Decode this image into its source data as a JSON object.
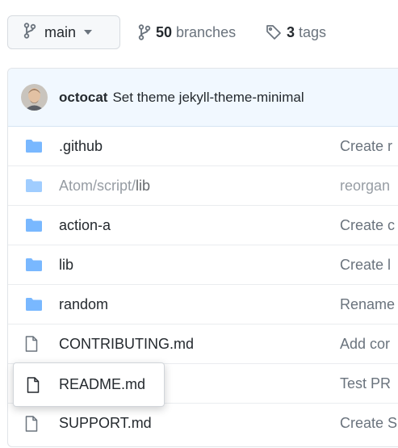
{
  "branch": {
    "name": "main"
  },
  "stats": {
    "branches_count": "50",
    "branches_label": "branches",
    "tags_count": "3",
    "tags_label": "tags"
  },
  "commit": {
    "author": "octocat",
    "message": "Set theme jekyll-theme-minimal"
  },
  "files": [
    {
      "name": ".github",
      "type": "folder",
      "commit_message": "Create r"
    },
    {
      "name_dim": "Atom/script/",
      "name": "lib",
      "type": "folder",
      "commit_message": "reorgan"
    },
    {
      "name": "action-a",
      "type": "folder",
      "commit_message": "Create c"
    },
    {
      "name": "lib",
      "type": "folder",
      "commit_message": "Create l"
    },
    {
      "name": "random",
      "type": "folder",
      "commit_message": "Rename"
    },
    {
      "name": "CONTRIBUTING.md",
      "type": "file",
      "commit_message": "Add cor"
    },
    {
      "name": "README.md",
      "type": "file",
      "commit_message": "Test PR"
    },
    {
      "name": "SUPPORT.md",
      "type": "file",
      "commit_message": "Create S"
    }
  ],
  "colors": {
    "folder_icon": "#79b8ff",
    "commit_bar_bg": "#f1f8ff",
    "muted_text": "#6a737d"
  },
  "icons": {
    "branch": "git-branch-icon",
    "tag": "tag-icon",
    "folder": "folder-icon",
    "file": "file-icon",
    "caret": "caret-down-icon"
  }
}
